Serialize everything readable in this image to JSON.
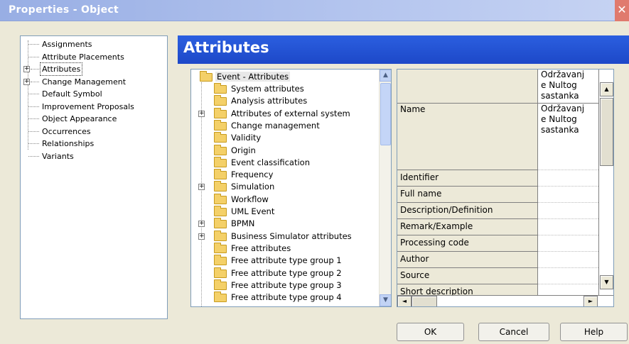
{
  "window": {
    "title": "Properties - Object",
    "close_glyph": "✕"
  },
  "nav": {
    "items": [
      {
        "label": "Assignments",
        "expandable": false
      },
      {
        "label": "Attribute Placements",
        "expandable": false
      },
      {
        "label": "Attributes",
        "expandable": true,
        "selected": true
      },
      {
        "label": "Change Management",
        "expandable": true
      },
      {
        "label": "Default Symbol",
        "expandable": false
      },
      {
        "label": "Improvement Proposals",
        "expandable": false
      },
      {
        "label": "Object Appearance",
        "expandable": false
      },
      {
        "label": "Occurrences",
        "expandable": false
      },
      {
        "label": "Relationships",
        "expandable": false
      },
      {
        "label": "Variants",
        "expandable": false
      }
    ]
  },
  "header": {
    "title": "Attributes"
  },
  "tree": {
    "root": "Event - Attributes",
    "items": [
      {
        "label": "System attributes",
        "expandable": false
      },
      {
        "label": "Analysis attributes",
        "expandable": false
      },
      {
        "label": "Attributes of external system",
        "expandable": true
      },
      {
        "label": "Change management",
        "expandable": false
      },
      {
        "label": "Validity",
        "expandable": false
      },
      {
        "label": "Origin",
        "expandable": false
      },
      {
        "label": "Event classification",
        "expandable": false
      },
      {
        "label": "Frequency",
        "expandable": false
      },
      {
        "label": "Simulation",
        "expandable": true
      },
      {
        "label": "Workflow",
        "expandable": false
      },
      {
        "label": "UML Event",
        "expandable": false
      },
      {
        "label": "BPMN",
        "expandable": true
      },
      {
        "label": "Business Simulator attributes",
        "expandable": true
      },
      {
        "label": "Free attributes",
        "expandable": false
      },
      {
        "label": "Free attribute type group 1",
        "expandable": false
      },
      {
        "label": "Free attribute type group 2",
        "expandable": false
      },
      {
        "label": "Free attribute type group 3",
        "expandable": false
      },
      {
        "label": "Free attribute type group 4",
        "expandable": false
      }
    ]
  },
  "grid": {
    "header_value": "Održavanje Nultog sastanka",
    "header_value_lines": [
      "Održavanj",
      "e Nultog",
      "sastanka"
    ],
    "rows": [
      {
        "name": "Name",
        "value_lines": [
          "Održavanj",
          "e Nultog",
          "sastanka"
        ]
      },
      {
        "name": "Identifier",
        "value_lines": []
      },
      {
        "name": "Full name",
        "value_lines": []
      },
      {
        "name": "Description/Definition",
        "value_lines": []
      },
      {
        "name": "Remark/Example",
        "value_lines": []
      },
      {
        "name": "Processing code",
        "value_lines": []
      },
      {
        "name": "Author",
        "value_lines": []
      },
      {
        "name": "Source",
        "value_lines": []
      },
      {
        "name": "Short description",
        "value_lines": []
      }
    ]
  },
  "scroll_glyphs": {
    "up": "▲",
    "down": "▼",
    "left": "◄",
    "right": "►"
  },
  "buttons": {
    "ok": "OK",
    "cancel": "Cancel",
    "help": "Help"
  }
}
